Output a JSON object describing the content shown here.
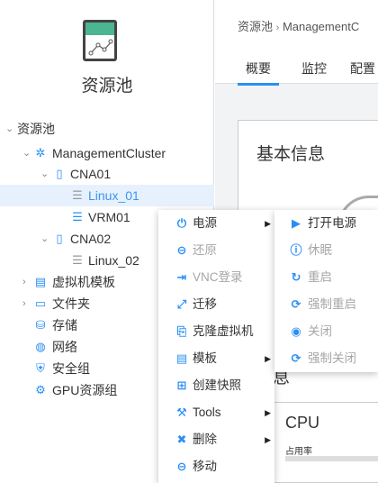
{
  "left_panel": {
    "title": "资源池"
  },
  "tree": [
    {
      "label": "资源池",
      "icon": "chevron",
      "expanded": true
    },
    {
      "label": "ManagementCluster",
      "icon": "cluster-icon",
      "expanded": true
    },
    {
      "label": "CNA01",
      "icon": "host-icon",
      "expanded": true
    },
    {
      "label": "Linux_01",
      "icon": "vm-icon",
      "selected": true
    },
    {
      "label": "VRM01",
      "icon": "vm-icon"
    },
    {
      "label": "CNA02",
      "icon": "host-icon",
      "expanded": true
    },
    {
      "label": "Linux_02",
      "icon": "vm-icon"
    },
    {
      "label": "虚拟机模板",
      "icon": "template-icon",
      "expanded": false
    },
    {
      "label": "文件夹",
      "icon": "folder-icon",
      "expanded": false
    },
    {
      "label": "存储",
      "icon": "storage-icon"
    },
    {
      "label": "网络",
      "icon": "network-icon"
    },
    {
      "label": "安全组",
      "icon": "shield-icon"
    },
    {
      "label": "GPU资源组",
      "icon": "gpu-icon"
    }
  ],
  "breadcrumb": {
    "root": "资源池",
    "separator": "›",
    "current": "ManagementC"
  },
  "tabs": [
    "概要",
    "监控",
    "配置"
  ],
  "card": {
    "title": "基本信息",
    "section2": "件信息",
    "cpu": "CPU",
    "usage_label": "占用率"
  },
  "context_menu": [
    {
      "label": "电源",
      "icon": "power-icon",
      "submenu": true
    },
    {
      "label": "还原",
      "icon": "restore-icon",
      "disabled": true
    },
    {
      "label": "VNC登录",
      "icon": "login-icon",
      "disabled": true
    },
    {
      "label": "迁移",
      "icon": "migrate-icon"
    },
    {
      "label": "克隆虚拟机",
      "icon": "clone-icon"
    },
    {
      "label": "模板",
      "icon": "template-icon",
      "submenu": true
    },
    {
      "label": "创建快照",
      "icon": "snapshot-icon"
    },
    {
      "label": "Tools",
      "icon": "wrench-icon",
      "submenu": true
    },
    {
      "label": "删除",
      "icon": "delete-icon",
      "submenu": true
    },
    {
      "label": "移动",
      "icon": "move-icon"
    }
  ],
  "power_submenu": [
    {
      "label": "打开电源",
      "icon": "play-icon"
    },
    {
      "label": "休眠",
      "icon": "pause-icon",
      "disabled": true
    },
    {
      "label": "重启",
      "icon": "restart-icon",
      "disabled": true
    },
    {
      "label": "强制重启",
      "icon": "force-restart-icon",
      "disabled": true
    },
    {
      "label": "关闭",
      "icon": "stop-icon",
      "disabled": true
    },
    {
      "label": "强制关闭",
      "icon": "force-stop-icon",
      "disabled": true
    }
  ],
  "colors": {
    "accent": "#2a8ff5",
    "selected_bg": "#e6f1fd",
    "logo_green": "#4cb592"
  }
}
